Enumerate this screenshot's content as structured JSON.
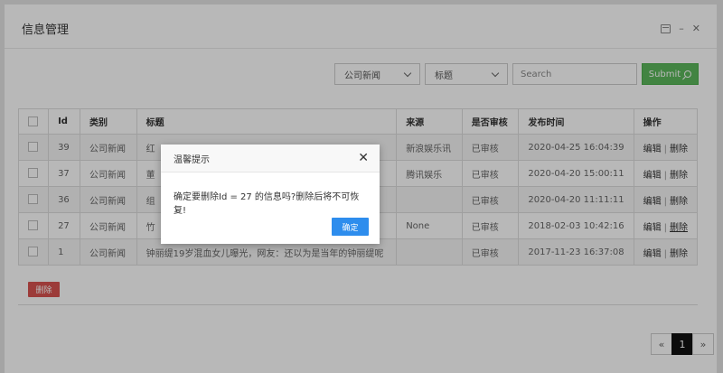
{
  "panel": {
    "title": "信息管理"
  },
  "filters": {
    "category_select": "公司新闻",
    "field_select": "标题",
    "search_placeholder": "Search",
    "submit_label": "Submit"
  },
  "table": {
    "headers": [
      "Id",
      "类别",
      "标题",
      "来源",
      "是否审核",
      "发布时间",
      "操作"
    ],
    "rows": [
      {
        "id": "39",
        "category": "公司新闻",
        "title": "红",
        "source": "新浪娱乐讯",
        "status": "已审核",
        "time": "2020-04-25 16:04:39"
      },
      {
        "id": "37",
        "category": "公司新闻",
        "title": "董",
        "source": "腾讯娱乐",
        "status": "已审核",
        "time": "2020-04-20 15:00:11"
      },
      {
        "id": "36",
        "category": "公司新闻",
        "title": "组",
        "source": "",
        "status": "已审核",
        "time": "2020-04-20 11:11:11"
      },
      {
        "id": "27",
        "category": "公司新闻",
        "title": "竹",
        "source": "None",
        "status": "已审核",
        "time": "2018-02-03 10:42:16"
      },
      {
        "id": "1",
        "category": "公司新闻",
        "title": "钟丽缇19岁混血女儿曝光，网友：还以为是当年的钟丽缇呢",
        "source": "",
        "status": "已审核",
        "time": "2017-11-23 16:37:08"
      }
    ],
    "edit_label": "编辑",
    "op_sep": "|",
    "delete_label": "删除"
  },
  "bulk_delete_label": "删除",
  "pagination": {
    "prev": "«",
    "current": "1",
    "next": "»"
  },
  "modal": {
    "title": "温馨提示",
    "close": "✕",
    "message": "确定要删除Id = 27 的信息吗?删除后将不可恢复!",
    "ok_label": "确定"
  }
}
